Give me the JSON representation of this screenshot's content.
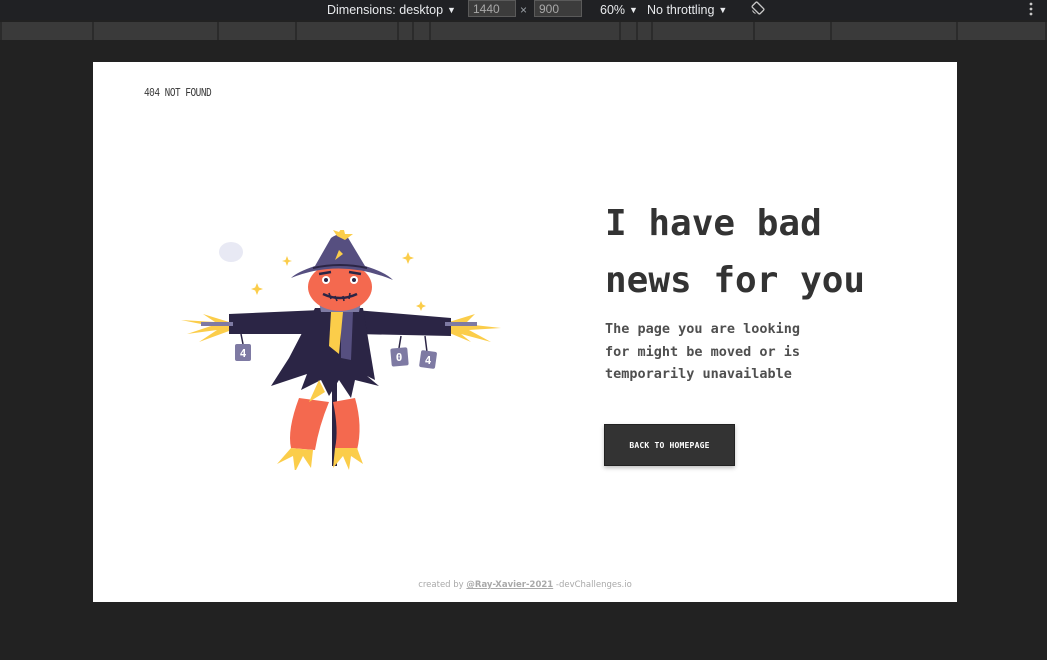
{
  "devtools": {
    "dimensions_label": "Dimensions: desktop",
    "width_value": "1440",
    "times_symbol": "×",
    "height_value": "900",
    "zoom_label": "60%",
    "throttling_label": "No throttling",
    "icons": [
      "rotate-icon",
      "more-options-icon"
    ]
  },
  "page": {
    "brand": "404 NOT FOUND",
    "headline_line1": "I have bad",
    "headline_line2": "news for you",
    "subtext_line1": "The page you are looking",
    "subtext_line2": "for might be moved or is",
    "subtext_line3": "temporarily unavailable",
    "button_label": "BACK TO HOMEPAGE",
    "footer_prefix": "created by ",
    "footer_author": "@Ray-Xavier-2021",
    "footer_suffix": " -devChallenges.io",
    "can_left": "4",
    "can_right_1": "0",
    "can_right_2": "4"
  },
  "colors": {
    "page_background": "#ffffff",
    "outer_background": "#222222",
    "text_dark": "#333333",
    "button_background": "#333333",
    "scarecrow_coat": "#2b2545",
    "scarecrow_face": "#f4694f",
    "straw": "#fbcd4a",
    "hat": "#564f80",
    "moon": "#e8e9f4"
  }
}
